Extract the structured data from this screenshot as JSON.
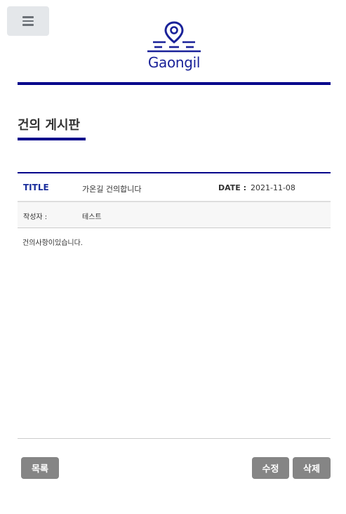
{
  "header": {
    "logo_text": "Gaongil",
    "menu_icon": "hamburger-menu-icon",
    "logo_icon": "map-pin-road-icon",
    "accent_color": "#00008b"
  },
  "board": {
    "title": "건의 게시판"
  },
  "post": {
    "title_label": "TITLE",
    "title_value": "가온길 건의합니다",
    "date_label": "DATE :",
    "date_value": "2021-11-08",
    "author_label": "작성자 :",
    "author_value": "테스트",
    "content": "건의사항이있습니다."
  },
  "actions": {
    "list_label": "목록",
    "edit_label": "수정",
    "delete_label": "삭제"
  }
}
